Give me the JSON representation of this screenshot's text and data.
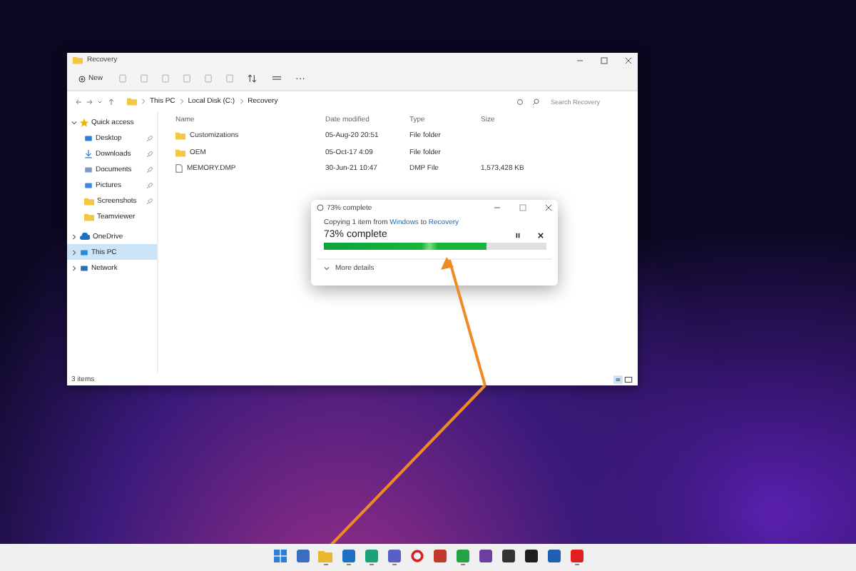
{
  "explorer": {
    "title": "Recovery",
    "new_button": "New",
    "more": "···",
    "path": [
      "This PC",
      "Local Disk (C:)",
      "Recovery"
    ],
    "search": {
      "placeholder": "Search Recovery"
    },
    "sidebar": [
      {
        "label": "Quick access",
        "kind": "star",
        "expanded": true,
        "selected": false,
        "children": [
          {
            "label": "Desktop",
            "kind": "desktop",
            "pinned": true,
            "selected": false
          },
          {
            "label": "Downloads",
            "kind": "download",
            "pinned": true,
            "selected": false
          },
          {
            "label": "Documents",
            "kind": "document",
            "pinned": true,
            "selected": false
          },
          {
            "label": "Pictures",
            "kind": "picture",
            "pinned": true,
            "selected": false
          },
          {
            "label": "Screenshots",
            "kind": "folder",
            "pinned": true,
            "selected": false
          },
          {
            "label": "Teamviewer",
            "kind": "folder",
            "pinned": false,
            "selected": false
          }
        ]
      },
      {
        "label": "OneDrive",
        "kind": "cloud",
        "expanded": false,
        "selected": false
      },
      {
        "label": "This PC",
        "kind": "pc",
        "expanded": false,
        "selected": true
      },
      {
        "label": "Network",
        "kind": "network",
        "expanded": false,
        "selected": false
      }
    ],
    "columns": [
      "Name",
      "Date modified",
      "Type",
      "Size"
    ],
    "rows": [
      {
        "kind": "folder",
        "name": "Customizations",
        "date": "05-Aug-20 20:51",
        "type": "File folder"
      },
      {
        "kind": "folder",
        "name": "OEM",
        "date": "05-Oct-17 4:09",
        "type": "File folder"
      },
      {
        "kind": "file",
        "name": "MEMORY.DMP",
        "date": "30-Jun-21 10:47",
        "type": "DMP File",
        "size": "1,573,428 KB"
      }
    ],
    "status": "3 items"
  },
  "dialog": {
    "title": "73% complete",
    "copy_prefix": "Copying 1 item from",
    "source": "Windows",
    "copy_middle": "to",
    "destination": "Recovery",
    "heading": "73% complete",
    "level": 0.73,
    "more_details": "More details"
  },
  "taskbar": [
    {
      "kind": "start",
      "color": "#2b7fd8",
      "running": false
    },
    {
      "kind": "app",
      "color": "#3a6fc0",
      "running": false
    },
    {
      "kind": "folder",
      "color": "#e8b830",
      "running": true
    },
    {
      "kind": "app",
      "color": "#1f6fc5",
      "running": true
    },
    {
      "kind": "app",
      "color": "#1aa37a",
      "running": true
    },
    {
      "kind": "app",
      "color": "#5a5fc8",
      "running": true
    },
    {
      "kind": "ring",
      "color": "#d8222a",
      "running": false
    },
    {
      "kind": "app",
      "color": "#c0392b",
      "running": false
    },
    {
      "kind": "app",
      "color": "#25a244",
      "running": true
    },
    {
      "kind": "app",
      "color": "#6b3fa0",
      "running": false
    },
    {
      "kind": "app",
      "color": "#333333",
      "running": false
    },
    {
      "kind": "app",
      "color": "#1e1e1e",
      "running": false
    },
    {
      "kind": "app",
      "color": "#1f5fb5",
      "running": false
    },
    {
      "kind": "app",
      "color": "#e02020",
      "running": true
    }
  ]
}
